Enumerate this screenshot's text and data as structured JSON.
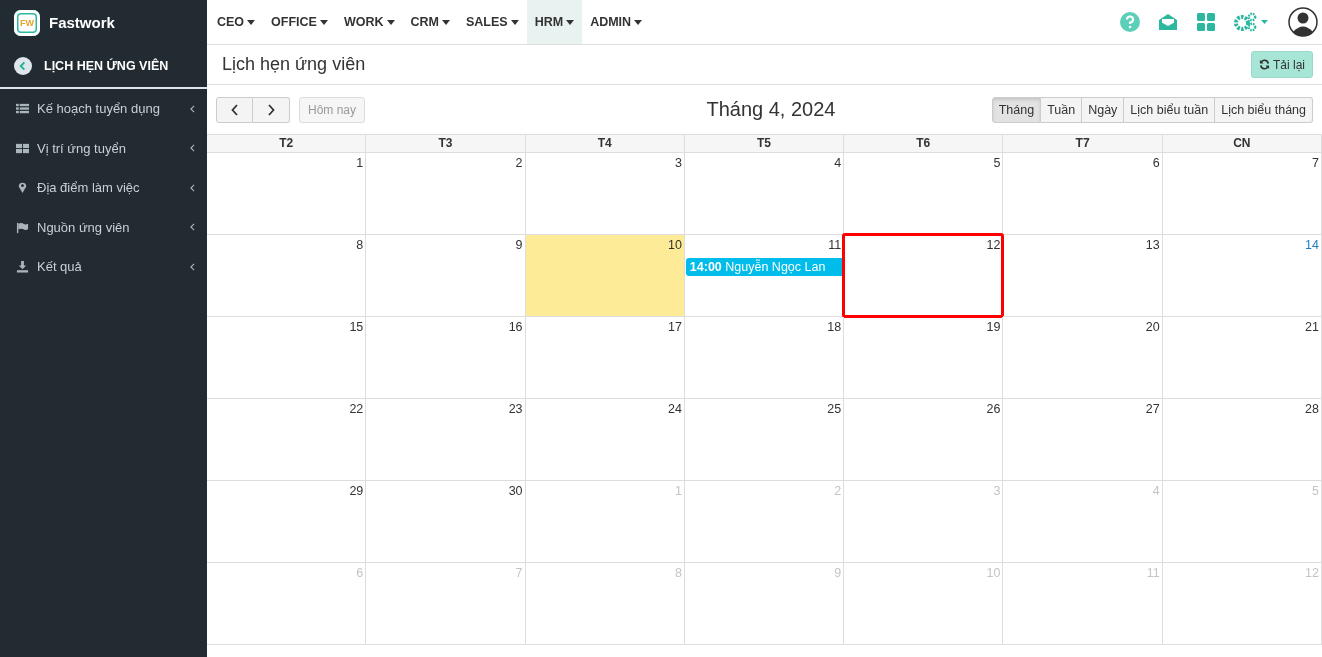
{
  "brand": {
    "logo": "FW",
    "name": "Fastwork"
  },
  "sidebar": {
    "back_title": "LỊCH HẸN ỨNG VIÊN",
    "items": [
      {
        "label": "Kế hoạch tuyển dụng"
      },
      {
        "label": "Vị trí ứng tuyển"
      },
      {
        "label": "Địa điểm làm việc"
      },
      {
        "label": "Nguồn ứng viên"
      },
      {
        "label": "Kết quả"
      }
    ]
  },
  "menu": [
    {
      "label": "CEO",
      "selected": false
    },
    {
      "label": "OFFICE",
      "selected": false
    },
    {
      "label": "WORK",
      "selected": false
    },
    {
      "label": "CRM",
      "selected": false
    },
    {
      "label": "SALES",
      "selected": false
    },
    {
      "label": "HRM",
      "selected": true
    },
    {
      "label": "ADMIN",
      "selected": false
    }
  ],
  "page_title": "Lịch hẹn ứng viên",
  "reload_button": "Tải lại",
  "today_button": "Hôm nay",
  "month_title": "Tháng 4, 2024",
  "views": [
    {
      "label": "Tháng",
      "selected": true
    },
    {
      "label": "Tuần",
      "selected": false
    },
    {
      "label": "Ngày",
      "selected": false
    },
    {
      "label": "Lịch biểu tuần",
      "selected": false
    },
    {
      "label": "Lịch biểu tháng",
      "selected": false
    }
  ],
  "weekdays": [
    "T2",
    "T3",
    "T4",
    "T5",
    "T6",
    "T7",
    "CN"
  ],
  "weeks": [
    [
      {
        "n": "1",
        "kind": "current",
        "today": false,
        "outlined": false
      },
      {
        "n": "2",
        "kind": "current",
        "today": false,
        "outlined": false
      },
      {
        "n": "3",
        "kind": "current",
        "today": false,
        "outlined": false
      },
      {
        "n": "4",
        "kind": "current",
        "today": false,
        "outlined": false
      },
      {
        "n": "5",
        "kind": "current",
        "today": false,
        "outlined": false
      },
      {
        "n": "6",
        "kind": "current",
        "today": false,
        "outlined": false
      },
      {
        "n": "7",
        "kind": "current",
        "today": false,
        "outlined": false
      }
    ],
    [
      {
        "n": "8",
        "kind": "current",
        "today": false,
        "outlined": false
      },
      {
        "n": "9",
        "kind": "current",
        "today": false,
        "outlined": false
      },
      {
        "n": "10",
        "kind": "current",
        "today": true,
        "outlined": false
      },
      {
        "n": "11",
        "kind": "current",
        "today": false,
        "outlined": false,
        "events": [
          {
            "time": "14:00",
            "title": "Nguyễn Ngọc Lan"
          }
        ]
      },
      {
        "n": "12",
        "kind": "current",
        "today": false,
        "outlined": true
      },
      {
        "n": "13",
        "kind": "current",
        "today": false,
        "outlined": false
      },
      {
        "n": "14",
        "kind": "hover",
        "today": false,
        "outlined": false
      }
    ],
    [
      {
        "n": "15",
        "kind": "current",
        "today": false,
        "outlined": false
      },
      {
        "n": "16",
        "kind": "current",
        "today": false,
        "outlined": false
      },
      {
        "n": "17",
        "kind": "current",
        "today": false,
        "outlined": false
      },
      {
        "n": "18",
        "kind": "current",
        "today": false,
        "outlined": false
      },
      {
        "n": "19",
        "kind": "current",
        "today": false,
        "outlined": false
      },
      {
        "n": "20",
        "kind": "current",
        "today": false,
        "outlined": false
      },
      {
        "n": "21",
        "kind": "current",
        "today": false,
        "outlined": false
      }
    ],
    [
      {
        "n": "22",
        "kind": "current",
        "today": false,
        "outlined": false
      },
      {
        "n": "23",
        "kind": "current",
        "today": false,
        "outlined": false
      },
      {
        "n": "24",
        "kind": "current",
        "today": false,
        "outlined": false
      },
      {
        "n": "25",
        "kind": "current",
        "today": false,
        "outlined": false
      },
      {
        "n": "26",
        "kind": "current",
        "today": false,
        "outlined": false
      },
      {
        "n": "27",
        "kind": "current",
        "today": false,
        "outlined": false
      },
      {
        "n": "28",
        "kind": "current",
        "today": false,
        "outlined": false
      }
    ],
    [
      {
        "n": "29",
        "kind": "current",
        "today": false,
        "outlined": false
      },
      {
        "n": "30",
        "kind": "current",
        "today": false,
        "outlined": false
      },
      {
        "n": "1",
        "kind": "other",
        "today": false,
        "outlined": false
      },
      {
        "n": "2",
        "kind": "other",
        "today": false,
        "outlined": false
      },
      {
        "n": "3",
        "kind": "other",
        "today": false,
        "outlined": false
      },
      {
        "n": "4",
        "kind": "other",
        "today": false,
        "outlined": false
      },
      {
        "n": "5",
        "kind": "other",
        "today": false,
        "outlined": false
      }
    ],
    [
      {
        "n": "6",
        "kind": "other",
        "today": false,
        "outlined": false
      },
      {
        "n": "7",
        "kind": "other",
        "today": false,
        "outlined": false
      },
      {
        "n": "8",
        "kind": "other",
        "today": false,
        "outlined": false
      },
      {
        "n": "9",
        "kind": "other",
        "today": false,
        "outlined": false
      },
      {
        "n": "10",
        "kind": "other",
        "today": false,
        "outlined": false
      },
      {
        "n": "11",
        "kind": "other",
        "today": false,
        "outlined": false
      },
      {
        "n": "12",
        "kind": "other",
        "today": false,
        "outlined": false
      }
    ]
  ]
}
